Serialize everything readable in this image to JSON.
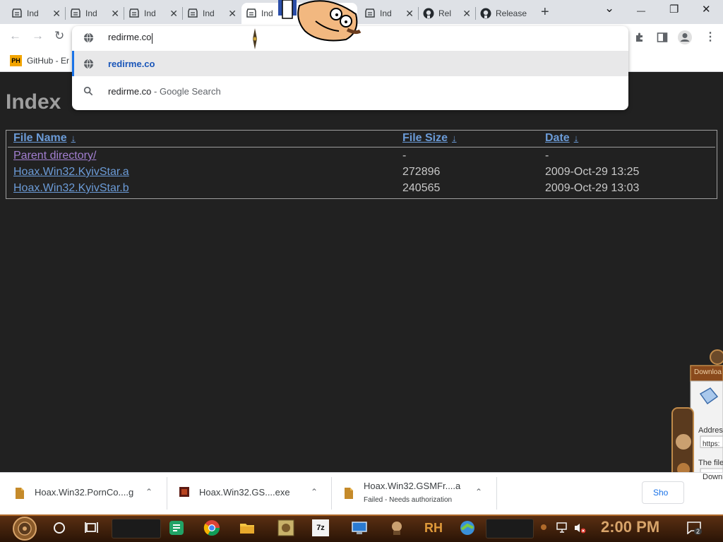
{
  "browser": {
    "tabs": [
      {
        "title": "Ind",
        "icon": "directory-icon"
      },
      {
        "title": "Ind",
        "icon": "directory-icon"
      },
      {
        "title": "Ind",
        "icon": "directory-icon"
      },
      {
        "title": "Ind",
        "icon": "directory-icon"
      },
      {
        "title": "Ind",
        "icon": "directory-icon",
        "active": true
      },
      {
        "title": "Ind",
        "icon": "directory-icon"
      },
      {
        "title": "Rel",
        "icon": "github-icon"
      },
      {
        "title": "Release",
        "icon": "github-icon"
      }
    ],
    "new_tab": "+",
    "window_controls": {
      "dropdown": "⌄",
      "minimize": "—",
      "restore": "❐",
      "close": "✕"
    },
    "nav": {
      "back": "←",
      "forward": "→",
      "reload": "↻"
    },
    "bookmarks": [
      {
        "label": "GitHub - Er",
        "icon": "ph-logo",
        "icon_text": "PH"
      }
    ]
  },
  "omnibox": {
    "input_value": "redirme.co",
    "suggestions": [
      {
        "text": "redirme.co",
        "hint": "",
        "icon": "globe-icon",
        "selected": true
      },
      {
        "text": "redirme.co",
        "hint": " - Google Search",
        "icon": "search-icon",
        "selected": false
      }
    ]
  },
  "page": {
    "title": "Index",
    "columns": [
      {
        "label": "File Name",
        "sort_arrow": "↓"
      },
      {
        "label": "File Size",
        "sort_arrow": "↓"
      },
      {
        "label": "Date",
        "sort_arrow": "↓"
      }
    ],
    "rows": [
      {
        "name": "Parent directory/",
        "size": "-",
        "date": "-",
        "visited": true
      },
      {
        "name": "Hoax.Win32.KyivStar.a",
        "size": "272896",
        "date": "2009-Oct-29 13:25",
        "visited": false
      },
      {
        "name": "Hoax.Win32.KyivStar.b",
        "size": "240565",
        "date": "2009-Oct-29 13:03",
        "visited": false
      }
    ]
  },
  "downloads": {
    "items": [
      {
        "name": "Hoax.Win32.PornCo....g",
        "status": ""
      },
      {
        "name": "Hoax.Win32.GS....exe",
        "status": ""
      },
      {
        "name": "Hoax.Win32.GSMFr....a",
        "status": "Failed - Needs authorization"
      }
    ],
    "show_all": "Sho"
  },
  "gadget": {
    "title": "Downloa",
    "address_label": "Addres",
    "address_value": "https:",
    "file_label": "The file",
    "button_label": "Downl"
  },
  "taskbar": {
    "clock": "2:00 PM",
    "notification_count": "2",
    "app_labels": {
      "sevenzip": "7z",
      "rh": "RH"
    }
  },
  "colors": {
    "page_bg": "#212121",
    "link": "#6b9bd7",
    "visited_link": "#a27fd0",
    "omnibox_selected_text": "#1a56b9",
    "clock": "#d8a46a"
  }
}
